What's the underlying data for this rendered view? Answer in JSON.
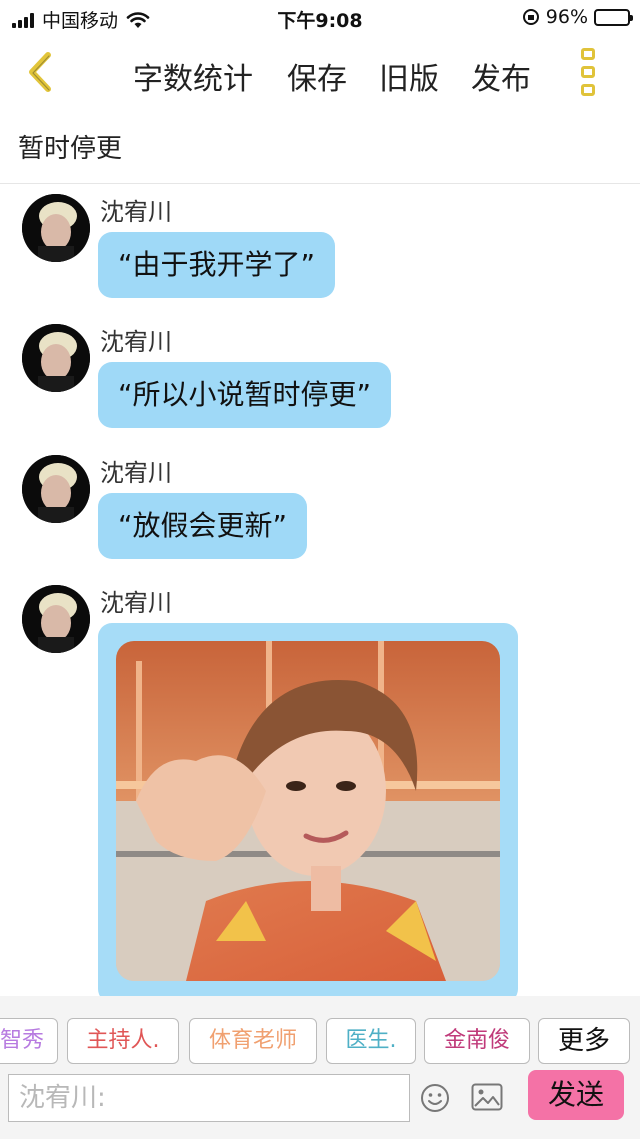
{
  "status_bar": {
    "carrier": "中国移动",
    "time": "下午9:08",
    "battery": "96%",
    "battery_level": 0.96
  },
  "nav": {
    "word_count": "字数统计",
    "save": "保存",
    "old_version": "旧版",
    "publish": "发布"
  },
  "title": "暂时停更",
  "messages": [
    {
      "sender": "沈宥川",
      "text": "“由于我开学了”"
    },
    {
      "sender": "沈宥川",
      "text": "“所以小说暂时停更”"
    },
    {
      "sender": "沈宥川",
      "text": "“放假会更新”"
    },
    {
      "sender": "沈宥川"
    }
  ],
  "chips": [
    "智秀",
    "主持人.",
    "体育老师",
    "医生.",
    "金南俊",
    "更多"
  ],
  "chip_colors": [
    "#b77be0",
    "#e05656",
    "#f0a070",
    "#4fb0c6",
    "#c03a7a",
    "#111111"
  ],
  "input": {
    "placeholder": "沈宥川:"
  },
  "send_label": "发送",
  "colors": {
    "bubble": "#9fd9f7",
    "send": "#f472a6",
    "accent": "#e0c33a"
  }
}
